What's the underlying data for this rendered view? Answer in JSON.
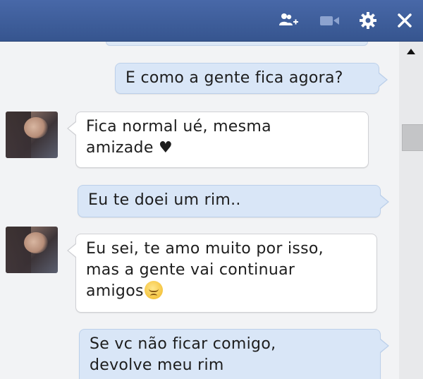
{
  "header": {
    "icons": [
      "add-friend-icon",
      "video-call-icon",
      "gear-icon",
      "close-icon"
    ]
  },
  "messages": [
    {
      "side": "out",
      "lines": [
        "E como a gente fica agora?"
      ]
    },
    {
      "side": "in",
      "lines": [
        "Fica normal ué, mesma",
        "amizade ♥"
      ]
    },
    {
      "side": "out",
      "lines": [
        "Eu te doei um rim.."
      ]
    },
    {
      "side": "in",
      "lines": [
        "Eu sei, te amo muito por isso,",
        "mas a gente vai continuar",
        "amigos"
      ],
      "emoji": "pensive-face-emoji"
    },
    {
      "side": "out",
      "lines": [
        "Se vc não ficar comigo,",
        "devolve meu rim"
      ]
    }
  ],
  "colors": {
    "header": "#3b5b98",
    "outgoing_bubble": "#d9e6f7",
    "incoming_bubble": "#ffffff",
    "chat_background": "#f2f3f5"
  }
}
